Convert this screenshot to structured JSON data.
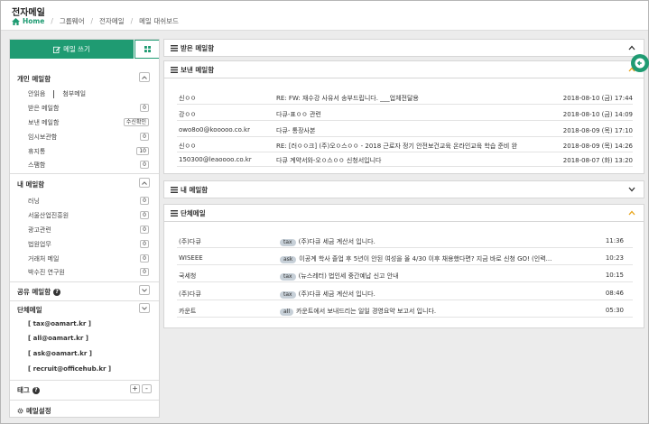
{
  "header": {
    "title": "전자메일",
    "breadcrumb": [
      "Home",
      "그룹웨어",
      "전자메일",
      "메일 대쉬보드"
    ]
  },
  "sidebar": {
    "compose_label": "메일 쓰기",
    "personal": {
      "title": "개인 메일함",
      "tabs": [
        "안읽음",
        "첨부메일"
      ],
      "items": [
        {
          "label": "받은 메일함",
          "count": "0"
        },
        {
          "label": "보낸 메일함",
          "count": "수신확인"
        },
        {
          "label": "임시보관함",
          "count": "0"
        },
        {
          "label": "휴지통",
          "count": "10"
        },
        {
          "label": "스팸함",
          "count": "0"
        }
      ]
    },
    "my": {
      "title": "내 메일함",
      "items": [
        {
          "label": "러닝",
          "count": "0"
        },
        {
          "label": "서울산업진흥원",
          "count": "0"
        },
        {
          "label": "광고관련",
          "count": "0"
        },
        {
          "label": "법원업무",
          "count": "0"
        },
        {
          "label": "거래처 메일",
          "count": "0"
        },
        {
          "label": "박수진 연구원",
          "count": "0"
        }
      ]
    },
    "shared_title": "공유 메일함",
    "group": {
      "title": "단체메일",
      "items": [
        "[ tax@oamart.kr ]",
        "[ all@oamart.kr ]",
        "[ ask@oamart.kr ]",
        "[ recruit@officehub.kr ]"
      ]
    },
    "tag_title": "태그",
    "tag_add": "+",
    "tag_remove": "-",
    "settings_label": "메일설정"
  },
  "panels": {
    "inbox": {
      "title": "받은 메일함"
    },
    "sent": {
      "title": "보낸 메일함",
      "rows": [
        {
          "to": "신ㅇㅇ",
          "subject": "RE: FW: 재수강 사유서 송부드립니다. ___업체전달용",
          "date": "2018-08-10 (금) 17:44"
        },
        {
          "to": "강ㅇㅇ",
          "subject": "다큐-표ㅇㅇ 관련",
          "date": "2018-08-10 (금) 14:09"
        },
        {
          "to": "owo8o0@kooooo.co.kr",
          "subject": "다큐- 통장사본",
          "date": "2018-08-09 (목) 17:10"
        },
        {
          "to": "신ㅇㅇ",
          "subject": "RE: [러ㅇㅇ크] (주)오ㅇ스ㅇㅇ - 2018 근로자 정기 안전보건교육 온라인교육 학습 준비 완",
          "date": "2018-08-09 (목) 14:26"
        },
        {
          "to": "150300@leaoooo.co.kr",
          "subject": "다큐 계약서와-오ㅇ스ㅇㅇ 신청서입니다",
          "date": "2018-08-07 (화) 13:20"
        }
      ]
    },
    "mine": {
      "title": "내 메일함"
    },
    "group": {
      "title": "단체메일",
      "rows": [
        {
          "from": "(주)다큐",
          "tag": "tax",
          "subject": "(주)다큐 세금 계산서 입니다.",
          "time": "11:36"
        },
        {
          "from": "WISEEE",
          "tag": "ask",
          "subject": "이공계 학사 졸업 후 5년이 안된 여성을 올 4/30 이후 채용했다면? 지금 바로 신청 GO! (인력...",
          "time": "10:23"
        },
        {
          "from": "국세청",
          "tag": "tax",
          "subject": "(뉴스레터) 법인세 중간예납 신고 안내",
          "time": "10:15"
        },
        {
          "from": "(주)다큐",
          "tag": "tax",
          "subject": "(주)다큐 세금 계산서 입니다.",
          "time": "08:46"
        },
        {
          "from": "카운트",
          "tag": "all",
          "subject": "카운트에서 보내드리는 일일 경영요약 보고서 입니다.",
          "time": "05:30"
        }
      ]
    }
  },
  "colors": {
    "accent": "#1f9b72",
    "badge": "#c7d0d8",
    "chevron_up": "#e8a317"
  }
}
